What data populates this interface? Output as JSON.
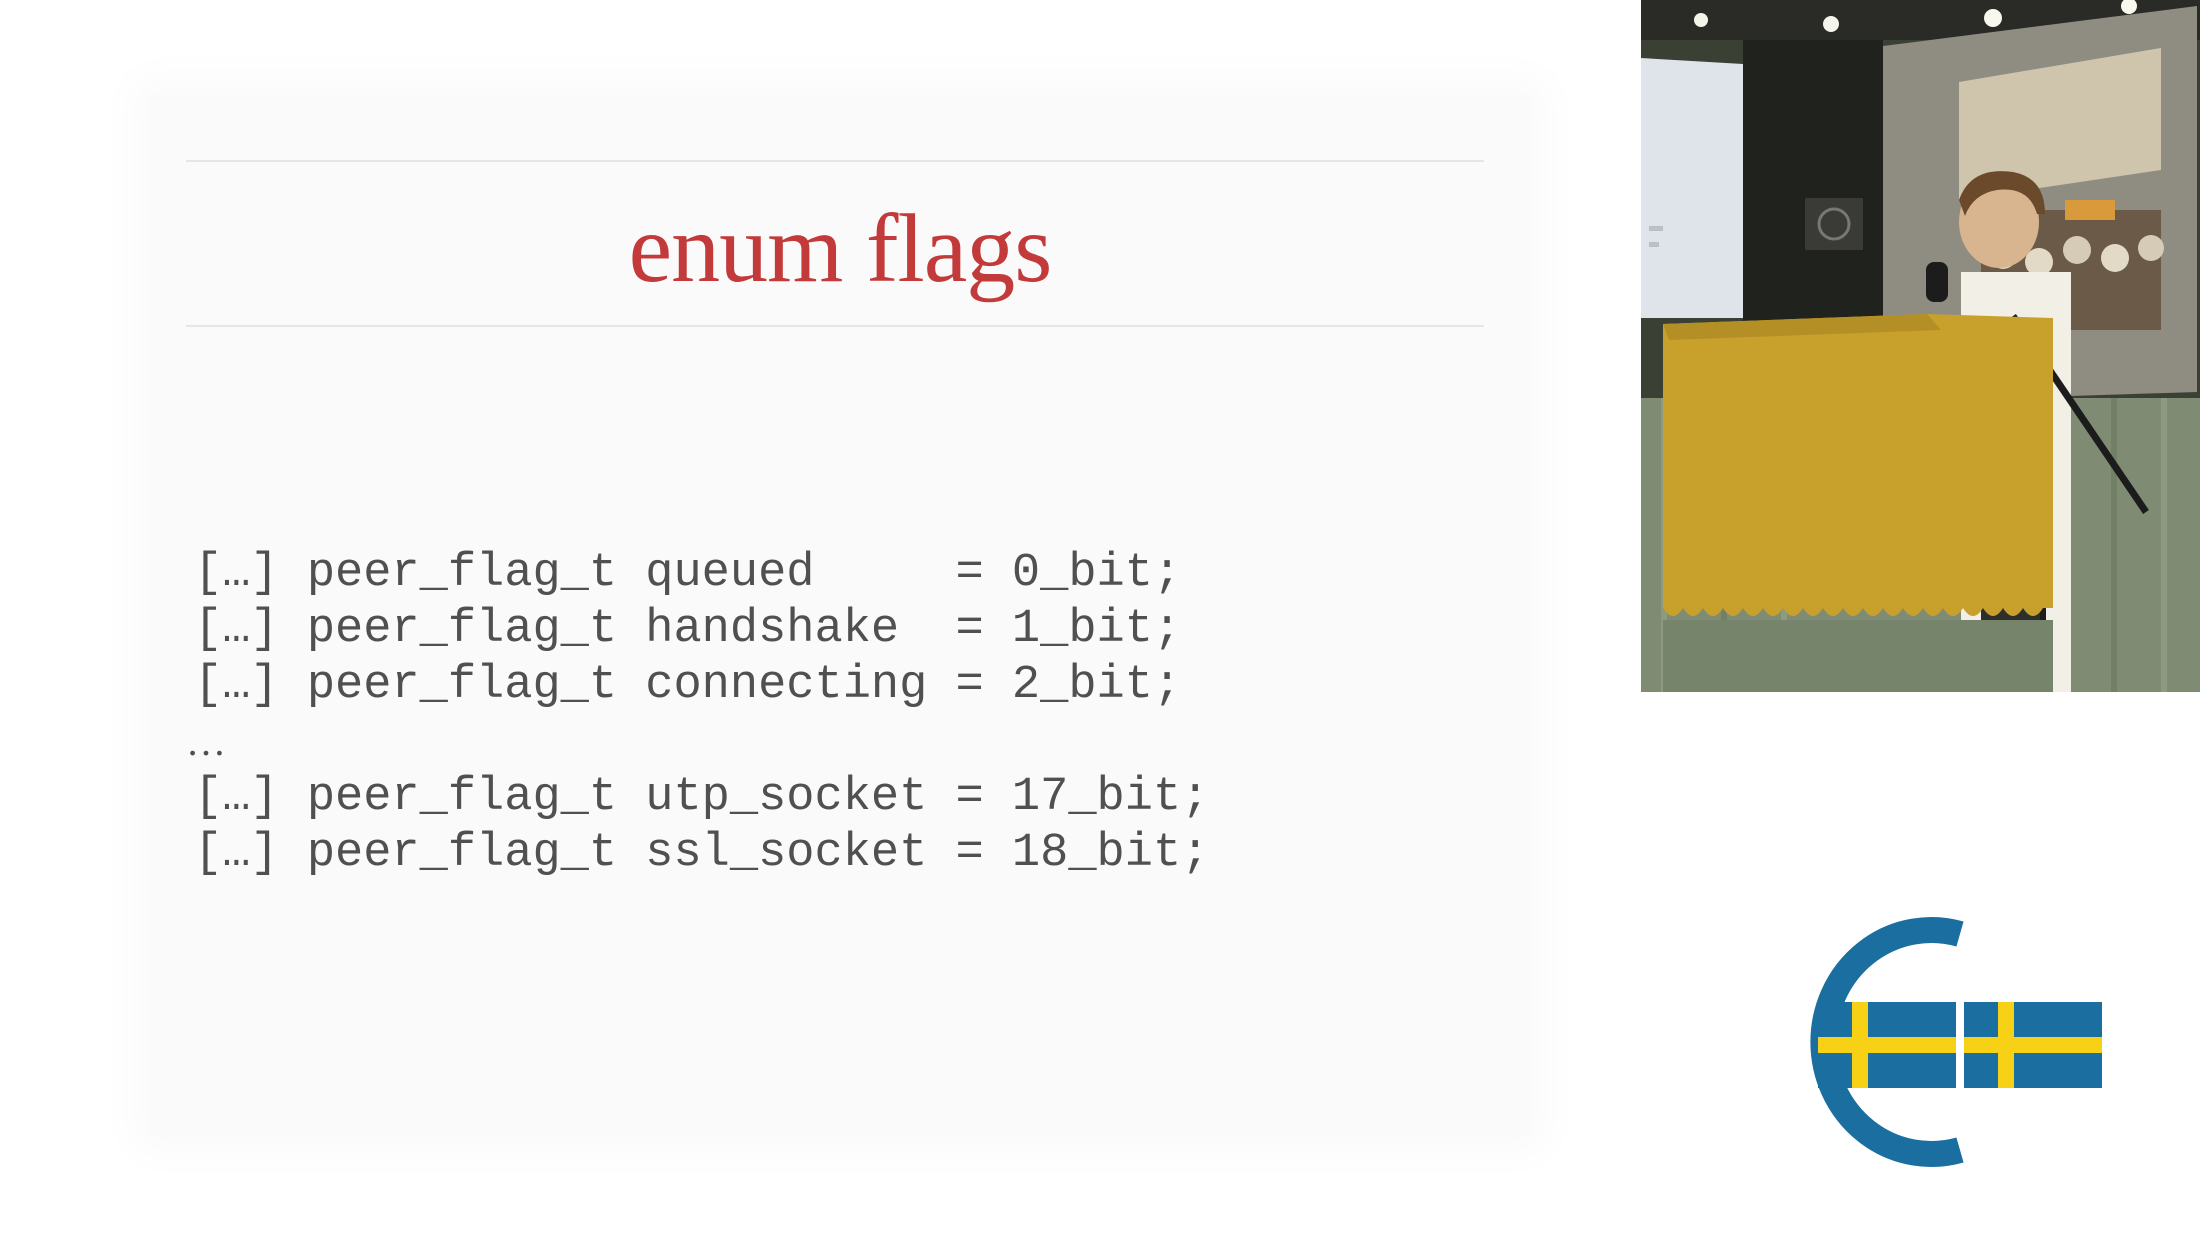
{
  "slide": {
    "title": "enum flags",
    "code_lines": [
      "[…] peer_flag_t queued     = 0_bit;",
      "[…] peer_flag_t handshake  = 1_bit;",
      "[…] peer_flag_t connecting = 2_bit;",
      "…",
      "[…] peer_flag_t utp_socket = 17_bit;",
      "[…] peer_flag_t ssl_socket = 18_bit;"
    ],
    "title_color": "#c23a3a"
  },
  "camera": {
    "subject": "speaker-at-podium"
  },
  "logo": {
    "icon": "conference-logo-icon",
    "colors": {
      "ring": "#1b6fa0",
      "flag_blue": "#1b6fa0",
      "flag_yellow": "#f7d116"
    }
  }
}
